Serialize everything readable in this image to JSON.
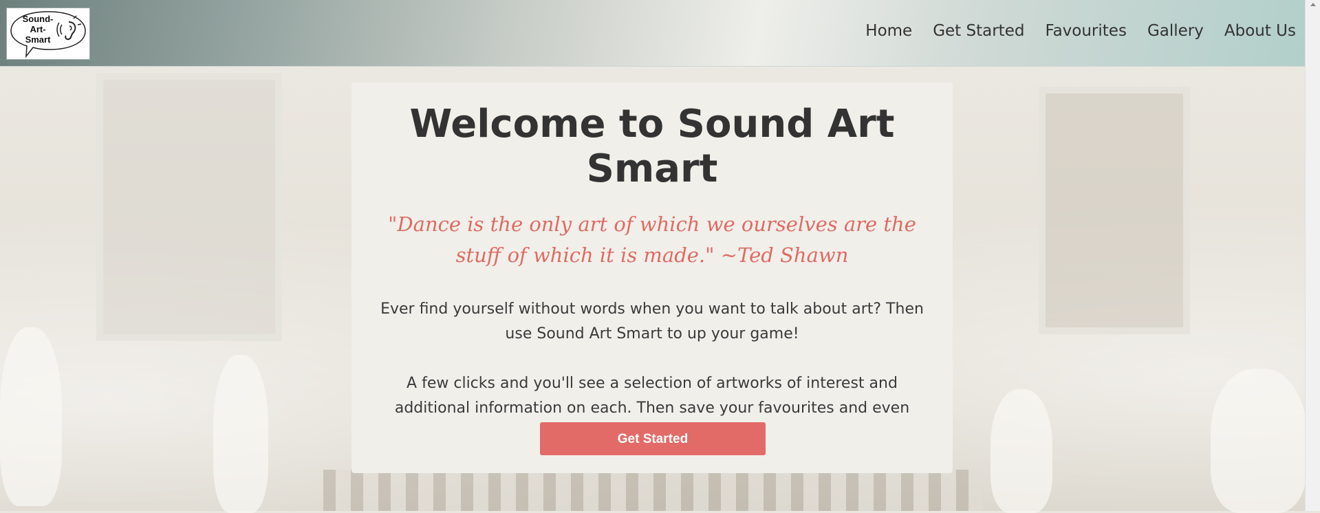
{
  "logo": {
    "lines": [
      "Sound-",
      "Art-",
      "Smart"
    ]
  },
  "nav": {
    "items": [
      "Home",
      "Get Started",
      "Favourites",
      "Gallery",
      "About Us"
    ]
  },
  "hero": {
    "title": "Welcome to Sound Art Smart",
    "quote": "\"Dance is the only art of which we ourselves are the stuff of which it is made.\" ~Ted Shawn",
    "paragraph1": "Ever find yourself without words when you want to talk about art? Then use Sound Art Smart to up your game!",
    "paragraph2": "A few clicks and you'll see a selection of artworks of interest and additional information on each. Then save your favourites and even create your own gallery!",
    "cta_label": "Get Started"
  },
  "colors": {
    "accent": "#e26b67",
    "quote": "#e06a62",
    "text": "#333333",
    "card_bg": "#f1efea"
  }
}
